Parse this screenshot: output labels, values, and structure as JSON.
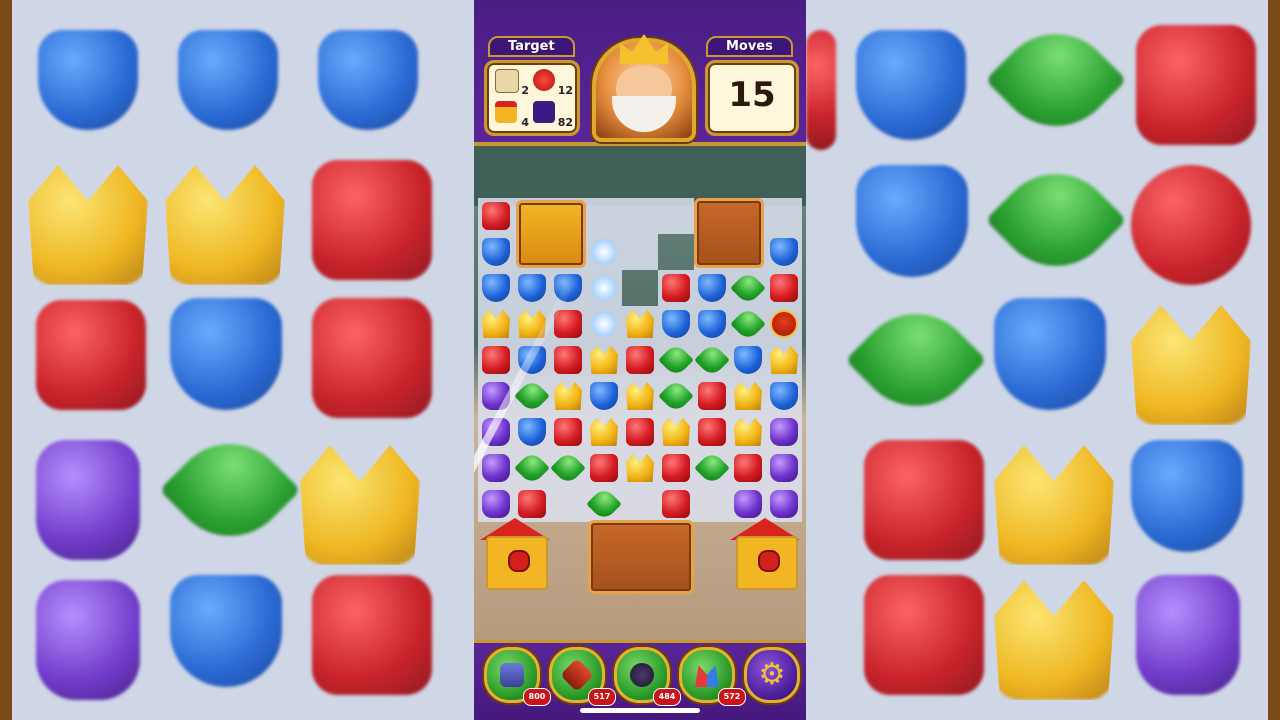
{
  "hud": {
    "target_label": "Target",
    "moves_label": "Moves",
    "moves_value": "15",
    "targets": [
      {
        "icon": "scroll-map-icon",
        "count": "2"
      },
      {
        "icon": "red-bird-icon",
        "count": "12"
      },
      {
        "icon": "birdhouse-icon",
        "count": "4"
      },
      {
        "icon": "purple-tile-icon",
        "count": "82"
      }
    ]
  },
  "boosters": [
    {
      "name": "hammer-booster",
      "count": "800"
    },
    {
      "name": "arrow-booster",
      "count": "517"
    },
    {
      "name": "cannon-booster",
      "count": "484"
    },
    {
      "name": "jester-hat-booster",
      "count": "572"
    }
  ],
  "settings_glyph": "⚙",
  "colors": {
    "top_bar": "#4a1d83",
    "accent_gold": "#c9982f",
    "red": "#d41c22",
    "blue": "#1e63d8",
    "green": "#22a428",
    "yellow": "#f3b516",
    "purple": "#6d32cc"
  }
}
